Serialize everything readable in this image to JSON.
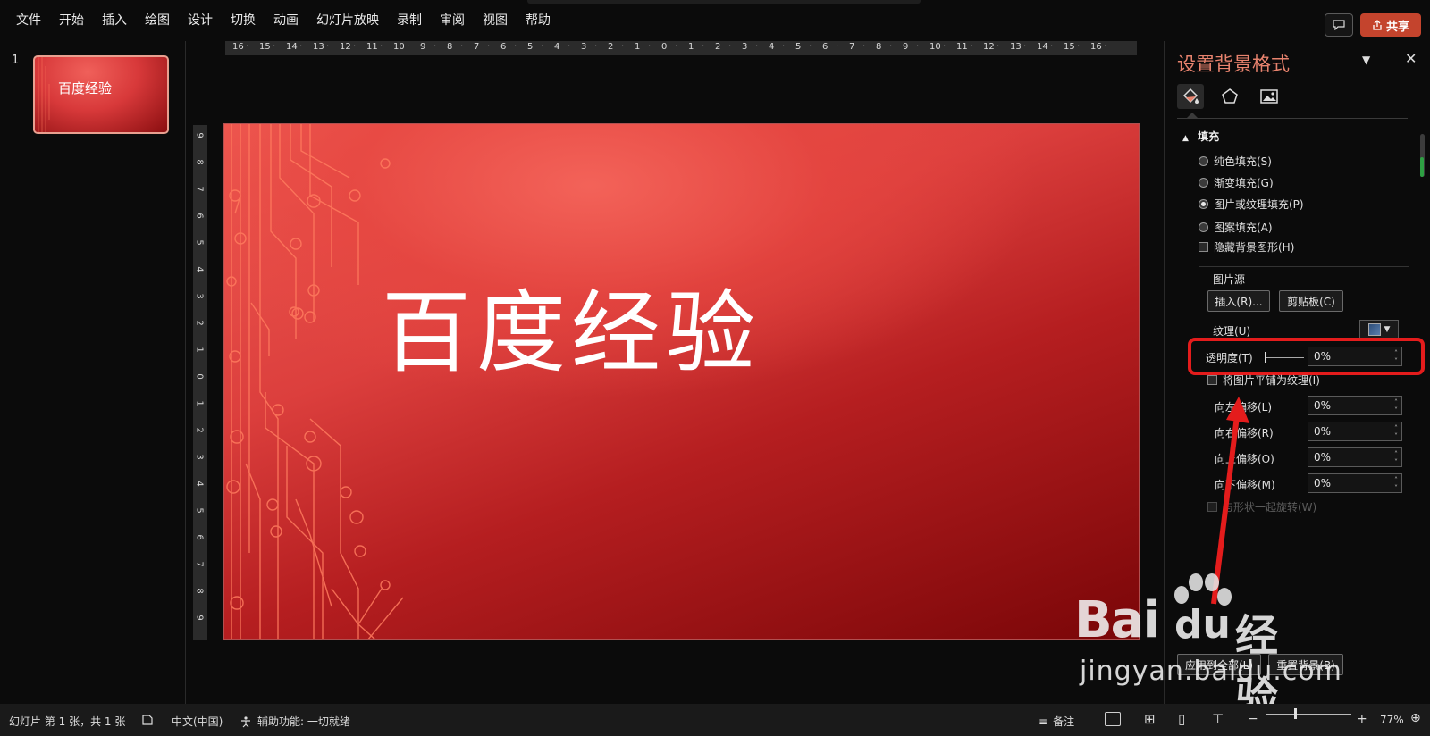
{
  "menu": {
    "items": [
      {
        "label": "文件"
      },
      {
        "label": "开始"
      },
      {
        "label": "插入"
      },
      {
        "label": "绘图"
      },
      {
        "label": "设计"
      },
      {
        "label": "切换"
      },
      {
        "label": "动画"
      },
      {
        "label": "幻灯片放映"
      },
      {
        "label": "录制"
      },
      {
        "label": "审阅"
      },
      {
        "label": "视图"
      },
      {
        "label": "帮助"
      }
    ],
    "share_label": "共享",
    "colors": {
      "share": "#c4442d"
    }
  },
  "thumbnails": {
    "slide_number": "1",
    "thumb_title": "百度经验"
  },
  "rulers": {
    "horizontal": [
      "16",
      "15",
      "14",
      "13",
      "12",
      "11",
      "10",
      "9",
      "8",
      "7",
      "6",
      "5",
      "4",
      "3",
      "2",
      "1",
      "0",
      "1",
      "2",
      "3",
      "4",
      "5",
      "6",
      "7",
      "8",
      "9",
      "10",
      "11",
      "12",
      "13",
      "14",
      "15",
      "16"
    ],
    "vertical": [
      "9",
      "8",
      "7",
      "6",
      "5",
      "4",
      "3",
      "2",
      "1",
      "0",
      "1",
      "2",
      "3",
      "4",
      "5",
      "6",
      "7",
      "8",
      "9"
    ]
  },
  "slide": {
    "title": "百度经验",
    "colors": {
      "light": "#ef5a52",
      "dark": "#7a0608",
      "circuit": "#ff7a5c"
    }
  },
  "format_pane": {
    "title": "设置背景格式",
    "section": "填充",
    "fill_options": [
      {
        "label": "纯色填充(S)",
        "selected": false
      },
      {
        "label": "渐变填充(G)",
        "selected": false
      },
      {
        "label": "图片或纹理填充(P)",
        "selected": true
      },
      {
        "label": "图案填充(A)",
        "selected": false
      }
    ],
    "hide_bg_graphics": "隐藏背景图形(H)",
    "picture_source_label": "图片源",
    "insert_button": "插入(R)...",
    "clipboard_button": "剪贴板(C)",
    "texture_label": "纹理(U)",
    "transparency_label": "透明度(T)",
    "transparency_value": "0%",
    "tile_label": "将图片平铺为纹理(I)",
    "offsets": [
      {
        "label": "向左偏移(L)",
        "value": "0%"
      },
      {
        "label": "向右偏移(R)",
        "value": "0%"
      },
      {
        "label": "向上偏移(O)",
        "value": "0%"
      },
      {
        "label": "向下偏移(M)",
        "value": "0%"
      }
    ],
    "rotate_label": "与形状一起旋转(W)",
    "apply_all_button": "应用到全部(L)",
    "reset_button": "重置背景(B)",
    "colors": {
      "title": "#e8836e",
      "highlight": "#e41c1c"
    }
  },
  "watermark": {
    "logo_text": "Bai",
    "logo_du": "du",
    "brand_cn": "经验",
    "url": "jingyan.baidu.com"
  },
  "statusbar": {
    "slide_info": "幻灯片 第 1 张，共 1 张",
    "language": "中文(中国)",
    "accessibility": "辅助功能: 一切就绪",
    "notes": "备注",
    "zoom_minus": "−",
    "zoom_plus": "+",
    "zoom": "77%"
  }
}
